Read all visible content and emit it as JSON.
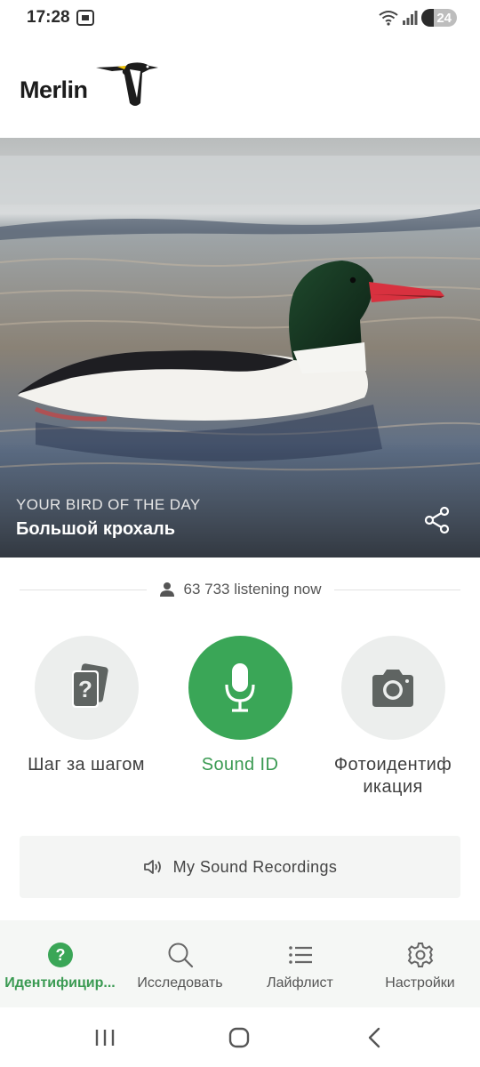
{
  "status_bar": {
    "time": "17:28",
    "battery": "24",
    "icons": [
      "screenshot-icon",
      "wifi-icon",
      "signal-icon",
      "battery-charging-icon"
    ]
  },
  "header": {
    "logo_text": "Merlin"
  },
  "hero": {
    "kicker": "YOUR BIRD OF THE DAY",
    "bird_name": "Большой крохаль",
    "share_icon": "share-icon"
  },
  "listening": {
    "count_text": "63 733 listening now",
    "icon": "person-icon"
  },
  "tools": [
    {
      "label": "Шаг за шагом",
      "icon": "question-cards-icon",
      "active": false
    },
    {
      "label": "Sound ID",
      "icon": "microphone-icon",
      "active": true
    },
    {
      "label": "Фотоидентиф икация",
      "icon": "camera-icon",
      "active": false
    }
  ],
  "recordings": {
    "label": "My Sound Recordings",
    "icon": "speaker-icon"
  },
  "bottom_nav": [
    {
      "label": "Идентифицир...",
      "icon": "question-circle-icon",
      "active": true
    },
    {
      "label": "Исследовать",
      "icon": "search-icon",
      "active": false
    },
    {
      "label": "Лайфлист",
      "icon": "list-icon",
      "active": false
    },
    {
      "label": "Настройки",
      "icon": "gear-icon",
      "active": false
    }
  ],
  "colors": {
    "accent": "#3aa657",
    "accent_text": "#3a9a52",
    "tool_bg": "#eceeed",
    "nav_bg": "#f5f7f5"
  }
}
